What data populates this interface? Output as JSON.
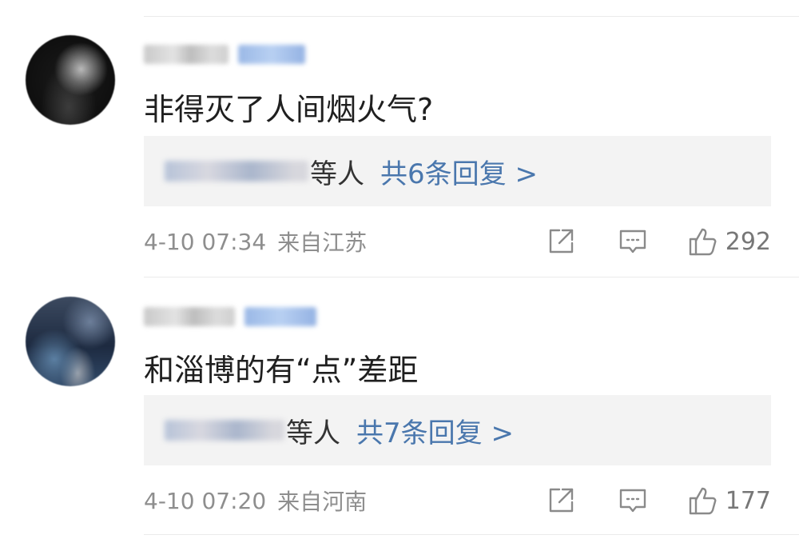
{
  "comments": [
    {
      "text": "非得灭了人间烟火气?",
      "replies": {
        "others_label": "等人",
        "count_label": "共6条回复 >"
      },
      "timestamp": "4-10 07:34",
      "location": "来自江苏",
      "likes": "292"
    },
    {
      "text": "和淄博的有“点”差距",
      "replies": {
        "others_label": "等人",
        "count_label": "共7条回复 >"
      },
      "timestamp": "4-10 07:20",
      "location": "来自河南",
      "likes": "177"
    }
  ],
  "icons": {
    "share": "share-icon",
    "comment": "comment-icon",
    "like": "thumbs-up-icon"
  },
  "colors": {
    "link": "#4a77ad",
    "meta": "#8e8e8e",
    "reply_bg": "#f3f3f3"
  }
}
